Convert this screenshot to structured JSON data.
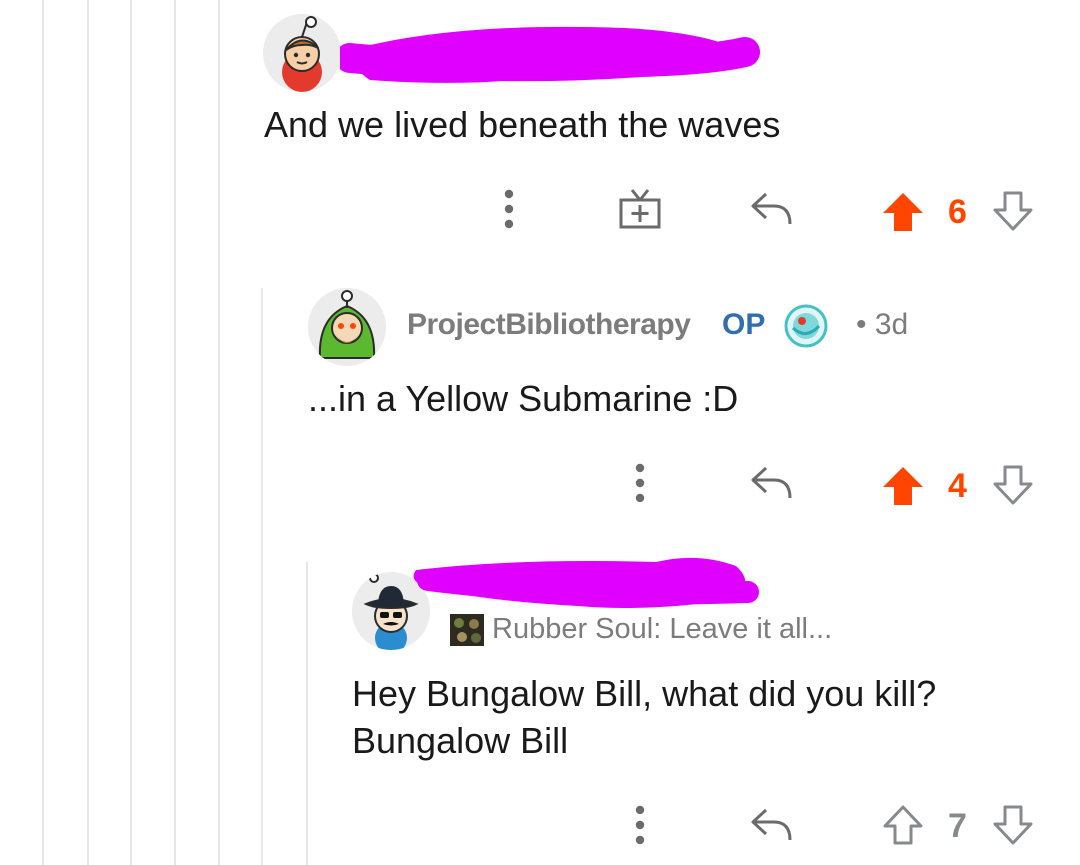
{
  "colors": {
    "upvoted": "#ff4500",
    "neutral": "#878a8c",
    "op_blue": "#2f6fb0",
    "redaction": "#e000ff",
    "thread_line": "#e6e6e6"
  },
  "comments": [
    {
      "username": "",
      "username_redacted": true,
      "body": "And we lived beneath the waves",
      "actions": [
        "more-icon",
        "gift-icon",
        "reply-icon"
      ],
      "vote": {
        "count": "6",
        "upvoted": true
      }
    },
    {
      "username": "ProjectBibliotherapy",
      "op_label": "OP",
      "age": "• 3d",
      "body": "...in a Yellow Submarine :D",
      "actions": [
        "more-icon",
        "reply-icon"
      ],
      "vote": {
        "count": "4",
        "upvoted": true
      }
    },
    {
      "username": "",
      "username_redacted": true,
      "flair": "Rubber Soul: Leave it all...",
      "body_lines": [
        "Hey Bungalow Bill, what did you kill?",
        "Bungalow Bill"
      ],
      "actions": [
        "more-icon",
        "reply-icon"
      ],
      "vote": {
        "count": "7",
        "upvoted": false
      }
    }
  ]
}
